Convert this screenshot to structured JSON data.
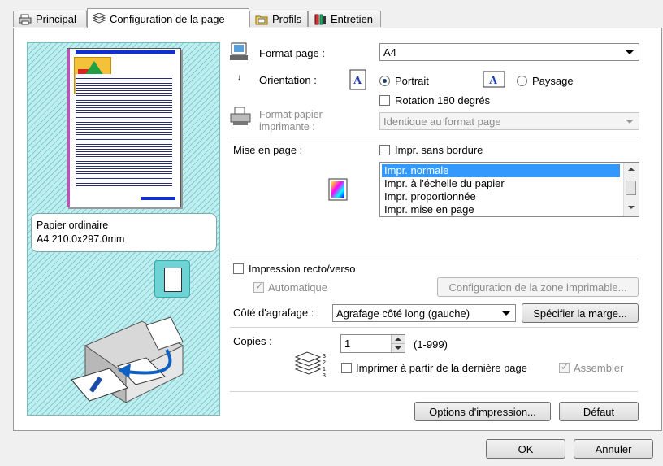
{
  "tabs": [
    {
      "label": "Principal",
      "icon": "printer-icon"
    },
    {
      "label": "Configuration de la page",
      "icon": "pages-icon"
    },
    {
      "label": "Profils",
      "icon": "folder-icon"
    },
    {
      "label": "Entretien",
      "icon": "tools-icon"
    }
  ],
  "preview": {
    "paper_type": "Papier ordinaire",
    "paper_size": "A4 210.0x297.0mm"
  },
  "page_size": {
    "label": "Format page :",
    "value": "A4"
  },
  "orientation": {
    "label": "Orientation :",
    "portrait": "Portrait",
    "landscape": "Paysage",
    "selected": "Portrait",
    "rotate_label": "Rotation 180 degrés",
    "rotate_checked": false
  },
  "printer_paper": {
    "label_line1": "Format papier",
    "label_line2": "imprimante :",
    "value": "Identique au format page"
  },
  "layout": {
    "label": "Mise en page :",
    "borderless_label": "Impr. sans bordure",
    "borderless_checked": false,
    "options": [
      "Impr. normale",
      "Impr. à l'échelle du papier",
      "Impr. proportionnée",
      "Impr. mise en page"
    ],
    "selected": "Impr. normale"
  },
  "duplex": {
    "label": "Impression recto/verso",
    "checked": false,
    "auto_label": "Automatique",
    "auto_checked": true,
    "print_area_button": "Configuration de la zone imprimable..."
  },
  "stapling": {
    "label": "Côté d'agrafage :",
    "value": "Agrafage côté long (gauche)",
    "margin_button": "Spécifier la marge..."
  },
  "copies": {
    "label": "Copies :",
    "value": "1",
    "range": "(1-999)",
    "reverse_label": "Imprimer à partir de la dernière page",
    "reverse_checked": false,
    "collate_label": "Assembler",
    "collate_checked": true
  },
  "buttons": {
    "print_options": "Options d'impression...",
    "defaults": "Défaut",
    "ok": "OK",
    "cancel": "Annuler"
  },
  "colors": {
    "accent": "#3399ff",
    "preview_bg": "#bdeff0",
    "page_bar": "#1030d0"
  }
}
